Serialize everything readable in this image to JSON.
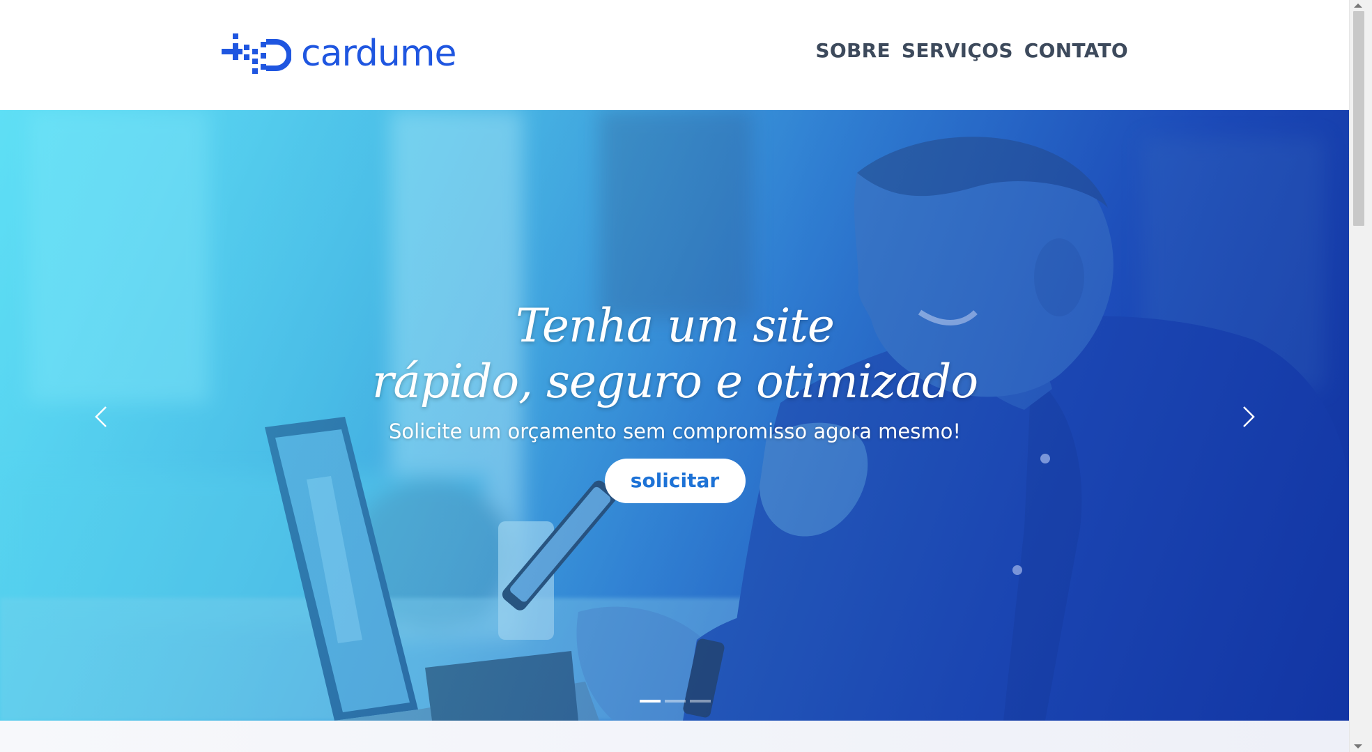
{
  "brand": {
    "name": "cardume",
    "accent_color": "#1f56e0",
    "logo_icon": "pixel-fish-logo-icon"
  },
  "nav": {
    "items": [
      {
        "label": "SOBRE"
      },
      {
        "label": "SERVIÇOS"
      },
      {
        "label": "CONTATO"
      }
    ]
  },
  "hero": {
    "title_line1": "Tenha um site",
    "title_line2": "rápido, seguro e otimizado",
    "subtitle": "Solicite um orçamento sem compromisso agora mesmo!",
    "cta_label": "solicitar",
    "prev_icon": "chevron-left-icon",
    "next_icon": "chevron-right-icon",
    "slide_count": 3,
    "active_slide": 1
  },
  "colors": {
    "nav_text": "#3d4a5c",
    "cta_text": "#1d72d6",
    "hero_gradient_start": "#6fe3f5",
    "hero_gradient_end": "#173a9a"
  }
}
